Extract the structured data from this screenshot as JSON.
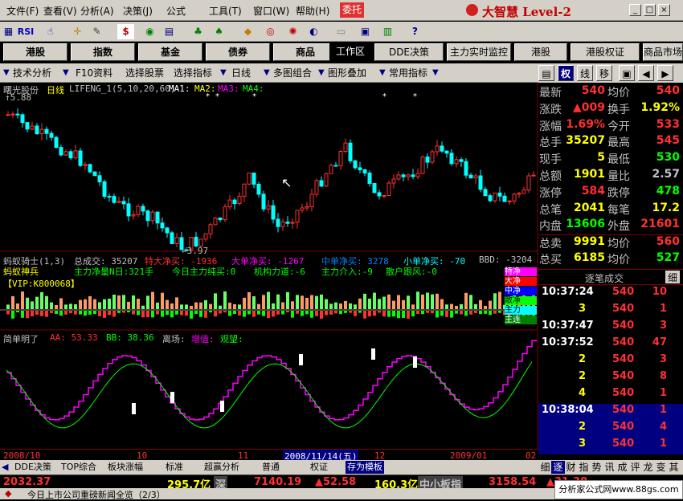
{
  "menu": {
    "items": [
      "文件(F)",
      "查看(V)",
      "分析(A)",
      "决策(J)",
      "公式",
      "工具(T)",
      "窗口(W)",
      "帮助(H)"
    ],
    "special": "委托",
    "brand": "大智慧 Level-2",
    "win_buttons": [
      "_",
      "□",
      "×"
    ]
  },
  "toolbar": {
    "rsi": "RSI",
    "dollar": "$"
  },
  "marketbar": {
    "left": [
      "港股",
      "指数",
      "基金",
      "债券",
      "商品"
    ],
    "right": [
      "工作区",
      "DDE决策",
      "主力实时监控",
      "港股",
      "港股权证",
      "商品市场"
    ]
  },
  "subbar": {
    "items": [
      "技术分析",
      "F10资料",
      "选择股票",
      "选择指标",
      "日线",
      "多图组合",
      "图形叠加",
      "常用指标"
    ]
  },
  "right_tabs": [
    "权",
    "线",
    "移"
  ],
  "main_chart": {
    "title": "曙光股份",
    "period": "日线",
    "indicator": "LIFENG_1(5,10,20,60)",
    "ma_labels": [
      "MA1:",
      "MA2:",
      "MA3:",
      "MA4:"
    ],
    "high_label": "↑5.88",
    "low_label": "←3.97"
  },
  "vol_panel": {
    "title": "蚂蚁骑士(1,3)",
    "total_vol": "总成交: 35207",
    "special_big": "特大净买: -1936",
    "big": "大单净买: -1267",
    "mid": "中单净买: 3278",
    "small": "小单净买: -70",
    "bbd": "BBD: -3204",
    "line2_title": "蚂蚁神兵",
    "line2_a": "主力净量N日:321手",
    "line2_b": "今日主力纯买:0",
    "line2_c": "机构力道:-6",
    "line2_d": "主力介入:-9",
    "line2_e": "散户跟风:-0",
    "vip": "【VIP:K800068】",
    "legend": [
      "特净",
      "大净",
      "中净",
      "散净",
      "主力",
      "主连"
    ]
  },
  "ind_panel": {
    "title": "简单明了",
    "aa": "AA: 53.33",
    "bb": "BB: 38.36",
    "lichang": "离场:",
    "zengzhi": "增值:",
    "guanwang": "观望:"
  },
  "date_axis": {
    "d1": "2008/10",
    "d2": "10",
    "d3": "11",
    "current": "2008/11/14(五)",
    "d4": "12",
    "d5": "2009/01",
    "d6": "02"
  },
  "quote": [
    {
      "k1": "最新",
      "v1": "540",
      "k2": "均价",
      "v2": "540"
    },
    {
      "k1": "涨跌",
      "v1": "▲009",
      "k2": "换手",
      "v2": "1.92%"
    },
    {
      "k1": "涨幅",
      "v1": "1.69%",
      "k2": "今开",
      "v2": "533"
    },
    {
      "k1": "总手",
      "v1": "35207",
      "k2": "最高",
      "v2": "545"
    },
    {
      "k1": "现手",
      "v1": "5",
      "k2": "最低",
      "v2": "530"
    },
    {
      "k1": "总额",
      "v1": "1901",
      "k2": "量比",
      "v2": "2.57"
    },
    {
      "k1": "涨停",
      "v1": "584",
      "k2": "跌停",
      "v2": "478"
    },
    {
      "k1": "总笔",
      "v1": "2041",
      "k2": "每笔",
      "v2": "17.2"
    },
    {
      "k1": "内盘",
      "v1": "13606",
      "k2": "外盘",
      "v2": "21601"
    },
    {
      "k1": "总卖",
      "v1": "9991",
      "k2": "均价",
      "v2": "560"
    },
    {
      "k1": "总买",
      "v1": "6185",
      "k2": "均价",
      "v2": "527"
    }
  ],
  "ticks_header": {
    "title": "逐笔成交",
    "tab": "细"
  },
  "ticks": [
    {
      "time": "10:37:24",
      "price": "540",
      "vol": "10"
    },
    {
      "time": "3",
      "price": "540",
      "vol": "1"
    },
    {
      "time": "10:37:47",
      "price": "540",
      "vol": "3"
    },
    {
      "time": "10:37:52",
      "price": "540",
      "vol": "47"
    },
    {
      "time": "2",
      "price": "540",
      "vol": "3"
    },
    {
      "time": "2",
      "price": "540",
      "vol": "8"
    },
    {
      "time": "4",
      "price": "540",
      "vol": "1"
    },
    {
      "time": "10:38:04",
      "price": "540",
      "vol": "1"
    },
    {
      "time": "2",
      "price": "540",
      "vol": "4"
    },
    {
      "time": "3",
      "price": "540",
      "vol": "1"
    }
  ],
  "bottom_tabs": [
    "DDE决策",
    "TOP综合",
    "板块涨幅",
    "标准",
    "超赢分析",
    "普通",
    "权证",
    "存为模板"
  ],
  "right_bottom_tabs": [
    "细",
    "逐",
    "财",
    "指",
    "势",
    "讯",
    "成",
    "评",
    "龙",
    "变",
    "其"
  ],
  "status": {
    "idx1": "2032.37",
    "amt1": "295.7亿",
    "mkt2": "深",
    "idx2": "7140.19",
    "chg2": "▲52.58",
    "amt2": "160.3亿",
    "mkt3": "中小板指",
    "idx3": "3158.54",
    "chg3": "▲31.38"
  },
  "news": "今日上市公司重磅新闻全览（2/3）",
  "watermark": "分析家公式网www.88gs.com",
  "colors": {
    "up": "#ff3030",
    "down": "#00ffff",
    "yellow": "#ffff00",
    "bg": "#000000",
    "panel": "#d4d0c8"
  }
}
